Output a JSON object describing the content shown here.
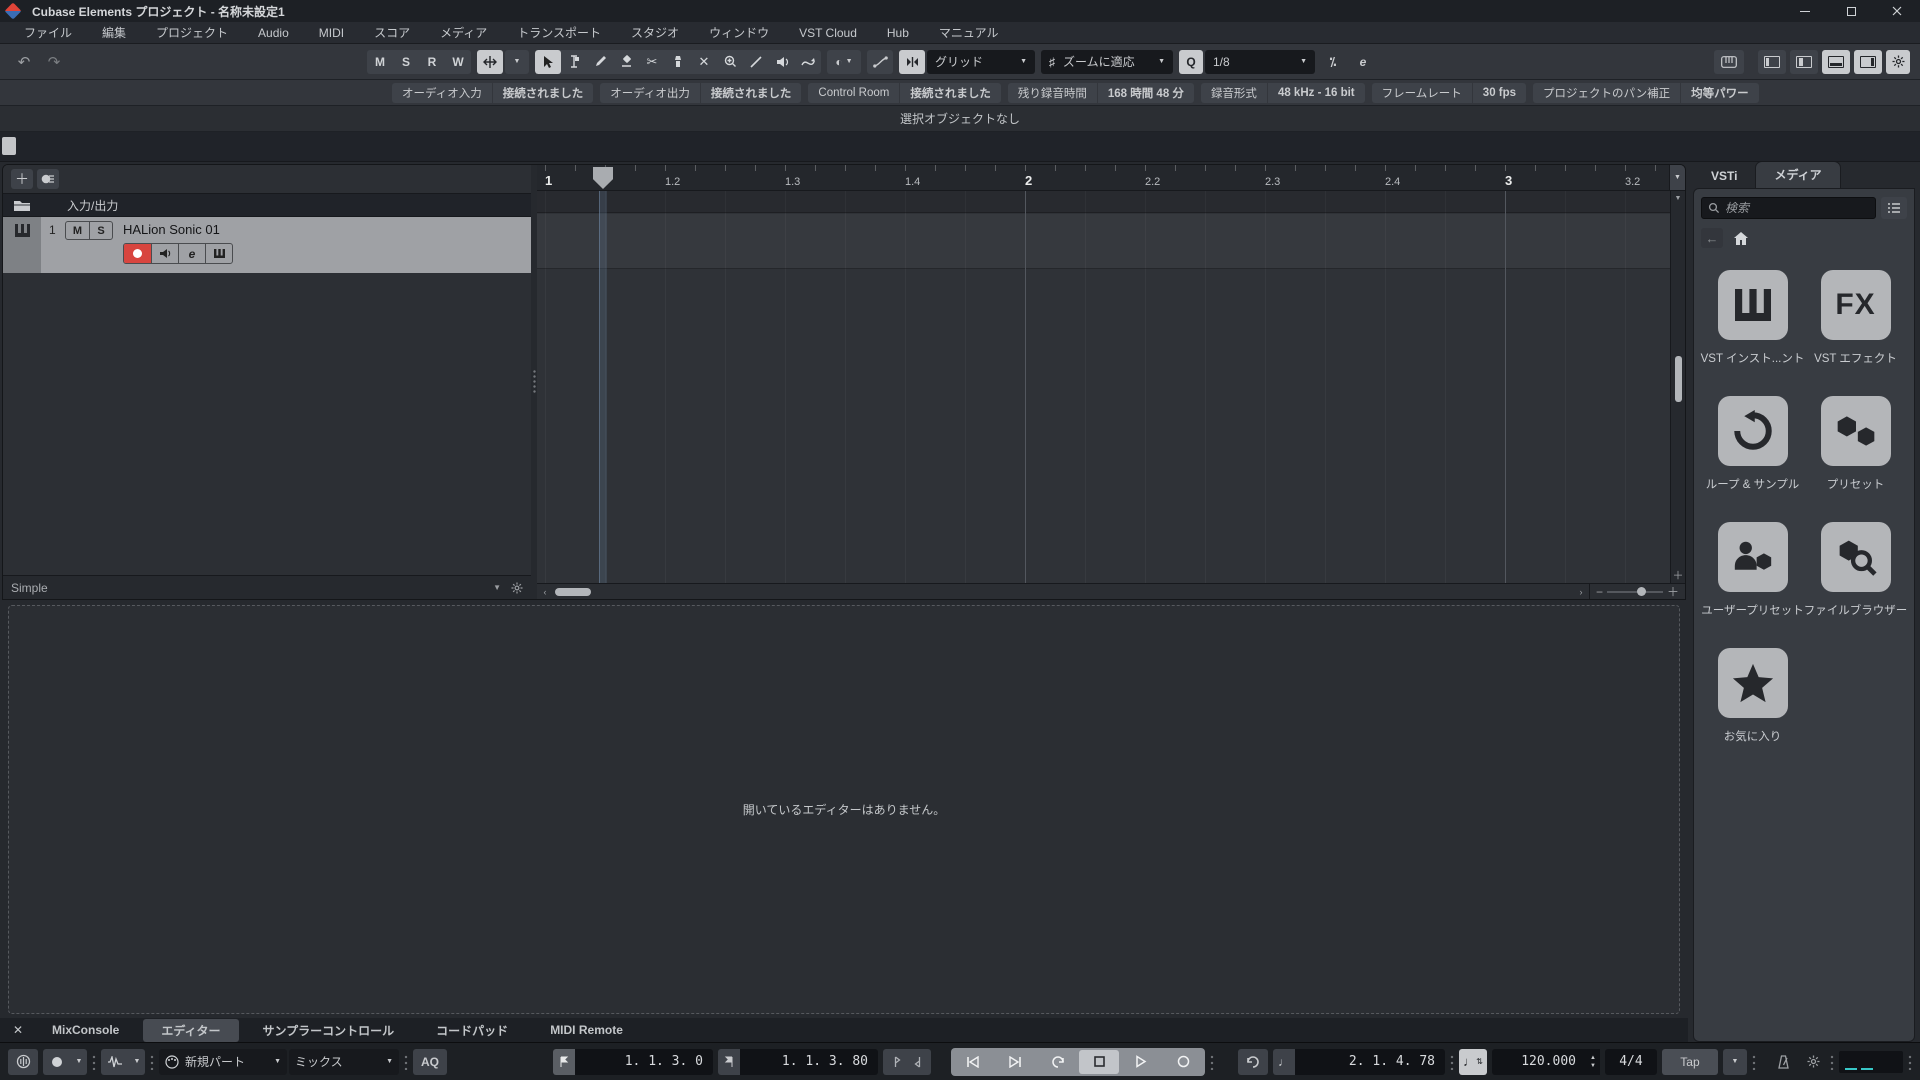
{
  "window": {
    "title": "Cubase Elements プロジェクト - 名称未設定1"
  },
  "menubar": {
    "items": [
      {
        "label": "ファイル"
      },
      {
        "label": "編集"
      },
      {
        "label": "プロジェクト"
      },
      {
        "label": "Audio"
      },
      {
        "label": "MIDI"
      },
      {
        "label": "スコア"
      },
      {
        "label": "メディア"
      },
      {
        "label": "トランスポート"
      },
      {
        "label": "スタジオ"
      },
      {
        "label": "ウィンドウ"
      },
      {
        "label": "VST Cloud"
      },
      {
        "label": "Hub"
      },
      {
        "label": "マニュアル"
      }
    ]
  },
  "toolbar": {
    "global_states": [
      "M",
      "S",
      "R",
      "W"
    ],
    "snap_type": "グリッド",
    "grid_type": "ズームに適応",
    "quantize_label": "Q",
    "quantize_value": "1/8"
  },
  "info_bar": {
    "pairs": [
      {
        "label": "オーディオ入力",
        "value": "接続されました"
      },
      {
        "label": "オーディオ出力",
        "value": "接続されました"
      },
      {
        "label": "Control Room",
        "value": "接続されました"
      },
      {
        "label": "残り録音時間",
        "value": "168 時間 48 分"
      },
      {
        "label": "録音形式",
        "value": "48 kHz - 16 bit"
      },
      {
        "label": "フレームレート",
        "value": "30 fps"
      },
      {
        "label": "プロジェクトのパン補正",
        "value": "均等パワー"
      }
    ]
  },
  "status_line": {
    "text": "選択オブジェクトなし"
  },
  "track_area": {
    "io_label": "入力/出力",
    "visibility_agent": "Simple",
    "tracks": [
      {
        "num": "1",
        "name": "HALion Sonic 01",
        "mute": "M",
        "solo": "S",
        "edit": "e"
      }
    ]
  },
  "ruler": {
    "labels": [
      "1",
      "1.2",
      "1.3",
      "1.4",
      "2",
      "2.2",
      "2.3",
      "2.4",
      "3",
      "3.2"
    ]
  },
  "lower_zone": {
    "empty_text": "開いているエディターはありません。",
    "tabs": [
      {
        "label": "MixConsole"
      },
      {
        "label": "エディター"
      },
      {
        "label": "サンプラーコントロール"
      },
      {
        "label": "コードパッド"
      },
      {
        "label": "MIDI Remote"
      }
    ]
  },
  "right_zone": {
    "tabs": [
      {
        "label": "VSTi"
      },
      {
        "label": "メディア"
      }
    ],
    "search_placeholder": "検索",
    "tiles": [
      {
        "label": "VST インスト...ント"
      },
      {
        "label": "VST エフェクト"
      },
      {
        "label": "ループ & サンプル"
      },
      {
        "label": "プリセット"
      },
      {
        "label": "ユーザープリセット"
      },
      {
        "label": "ファイルブラウザー"
      },
      {
        "label": "お気に入り"
      }
    ]
  },
  "transport": {
    "midi_record_part": "新規パート",
    "midi_record_mode": "ミックス",
    "aq_label": "AQ",
    "left_locator": "1. 1. 3. 0",
    "right_locator": "1. 1. 3. 80",
    "position": "2. 1. 4. 78",
    "tempo": "120.000",
    "time_signature": "4/4",
    "tap_label": "Tap"
  },
  "colors": {
    "record_red": "#d8453f",
    "selected_track_bg": "#9fa1a5",
    "tile_bg": "#b4b6b9",
    "meter_teal": "#38c7c7",
    "active_button_bg": "#c9cbce"
  }
}
